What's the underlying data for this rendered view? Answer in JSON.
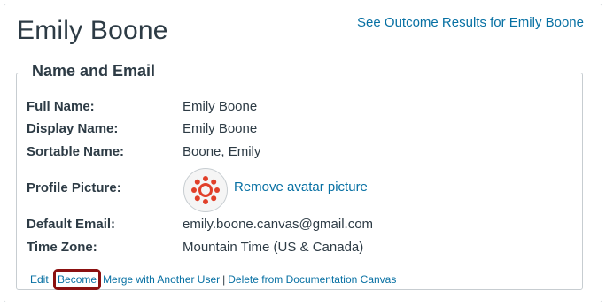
{
  "page": {
    "title": "Emily Boone",
    "outcome_link": "See Outcome Results for Emily Boone"
  },
  "section": {
    "legend": "Name and Email",
    "fields": [
      {
        "label": "Full Name:",
        "value": "Emily Boone"
      },
      {
        "label": "Display Name:",
        "value": "Emily Boone"
      },
      {
        "label": "Sortable Name:",
        "value": "Boone, Emily"
      },
      {
        "label": "Profile Picture:",
        "value": ""
      },
      {
        "label": "Default Email:",
        "value": "emily.boone.canvas@gmail.com"
      },
      {
        "label": "Time Zone:",
        "value": "Mountain Time (US & Canada)"
      }
    ],
    "remove_avatar": "Remove avatar picture",
    "avatar_icon": "canvas-logo-icon",
    "highlight_color": "#8b1111",
    "link_color": "#0770a3",
    "logo_color": "#e13f29"
  },
  "actions": {
    "edit": "Edit",
    "become": "Become",
    "merge": "Merge with Another User",
    "separator": "|",
    "delete": "Delete from Documentation Canvas"
  }
}
